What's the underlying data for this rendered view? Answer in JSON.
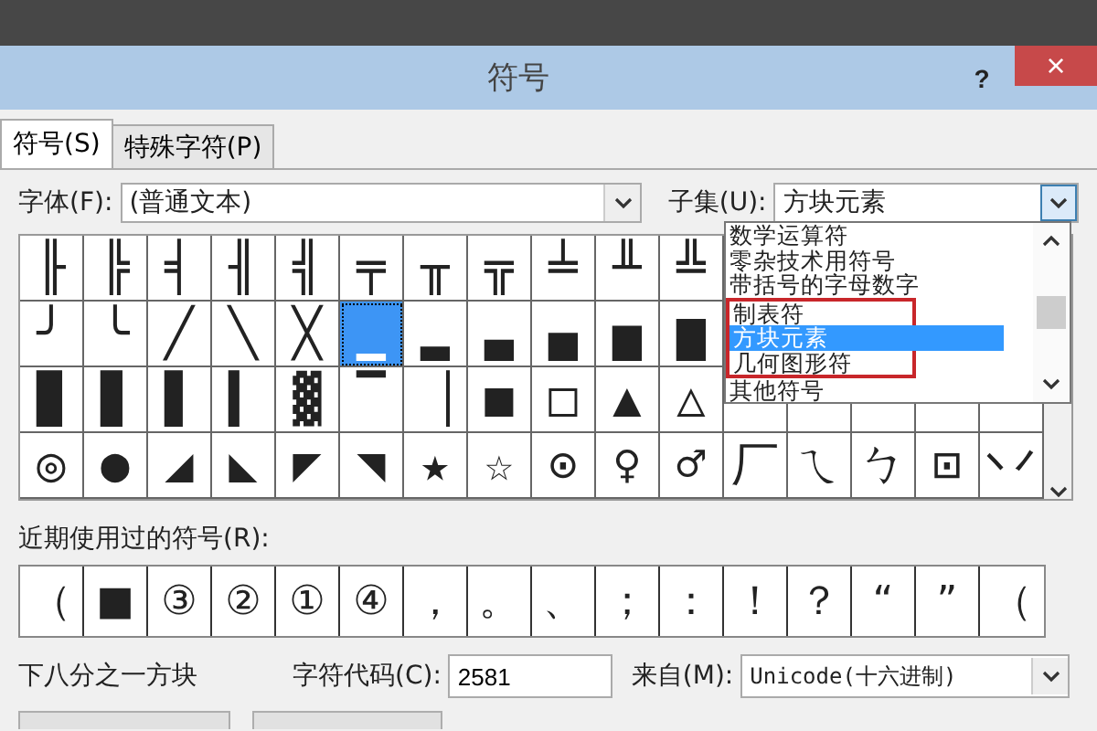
{
  "window": {
    "title": "符号",
    "help": "?",
    "close": "×"
  },
  "tabs": [
    {
      "label": "符号(S)",
      "selected": true
    },
    {
      "label": "特殊字符(P)",
      "selected": false
    }
  ],
  "font": {
    "label": "字体(F):",
    "value": "(普通文本)"
  },
  "subset": {
    "label": "子集(U):",
    "value": "方块元素",
    "expanded": true
  },
  "subset_options": [
    {
      "label": "数学运算符",
      "selected": false,
      "boxed": false
    },
    {
      "label": "零杂技术用符号",
      "selected": false,
      "boxed": false
    },
    {
      "label": "带括号的字母数字",
      "selected": false,
      "boxed": false
    },
    {
      "label": "制表符",
      "selected": false,
      "boxed": true
    },
    {
      "label": "方块元素",
      "selected": true,
      "boxed": true
    },
    {
      "label": "几何图形符",
      "selected": false,
      "boxed": true
    },
    {
      "label": "其他符号",
      "selected": false,
      "boxed": false
    }
  ],
  "symbols": [
    [
      {
        "char": "╟",
        "selected": false
      },
      {
        "char": "╠",
        "selected": false
      },
      {
        "char": "╡",
        "selected": false
      },
      {
        "char": "╢",
        "selected": false
      },
      {
        "char": "╣",
        "selected": false
      },
      {
        "char": "╤",
        "selected": false
      },
      {
        "char": "╥",
        "selected": false
      },
      {
        "char": "╦",
        "selected": false
      },
      {
        "char": "╧",
        "selected": false
      },
      {
        "char": "╨",
        "selected": false
      },
      {
        "char": "╩",
        "selected": false
      }
    ],
    [
      {
        "char": "╯",
        "selected": false
      },
      {
        "char": "╰",
        "selected": false
      },
      {
        "char": "╱",
        "selected": false
      },
      {
        "char": "╲",
        "selected": false
      },
      {
        "char": "╳",
        "selected": false
      },
      {
        "char": "▁",
        "selected": true
      },
      {
        "char": "▂",
        "selected": false
      },
      {
        "char": "▃",
        "selected": false
      },
      {
        "char": "▄",
        "selected": false
      },
      {
        "char": "▅",
        "selected": false
      },
      {
        "char": "▆",
        "selected": false
      }
    ],
    [
      {
        "char": "▉",
        "selected": false
      },
      {
        "char": "▊",
        "selected": false
      },
      {
        "char": "▋",
        "selected": false
      },
      {
        "char": "▍",
        "selected": false
      },
      {
        "char": "▓",
        "selected": false
      },
      {
        "char": "▔",
        "selected": false
      },
      {
        "char": "▕",
        "selected": false
      },
      {
        "char": "■",
        "selected": false
      },
      {
        "char": "□",
        "selected": false
      },
      {
        "char": "▲",
        "selected": false
      },
      {
        "char": "△",
        "selected": false
      }
    ],
    [
      {
        "char": "◎",
        "selected": false
      },
      {
        "char": "●",
        "selected": false
      },
      {
        "char": "◢",
        "selected": false
      },
      {
        "char": "◣",
        "selected": false
      },
      {
        "char": "◤",
        "selected": false
      },
      {
        "char": "◥",
        "selected": false
      },
      {
        "char": "★",
        "selected": false
      },
      {
        "char": "☆",
        "selected": false
      },
      {
        "char": "⊙",
        "selected": false
      },
      {
        "char": "♀",
        "selected": false
      },
      {
        "char": "♂",
        "selected": false
      },
      {
        "char": "厂",
        "selected": false
      },
      {
        "char": "ㄟ",
        "selected": false
      },
      {
        "char": "ㄅ",
        "selected": false
      },
      {
        "char": "⊡",
        "selected": false
      },
      {
        "char": "丷",
        "selected": false
      }
    ]
  ],
  "recent": {
    "label": "近期使用过的符号(R):",
    "symbols": [
      "（",
      "■",
      "③",
      "②",
      "①",
      "④",
      "，",
      "。",
      "、",
      "；",
      "：",
      "！",
      "？",
      "“",
      "”",
      "（"
    ]
  },
  "character_name": "下八分之一方块",
  "char_code": {
    "label": "字符代码(C):",
    "value": "2581"
  },
  "from": {
    "label": "来自(M):",
    "value": "Unicode(十六进制)"
  }
}
